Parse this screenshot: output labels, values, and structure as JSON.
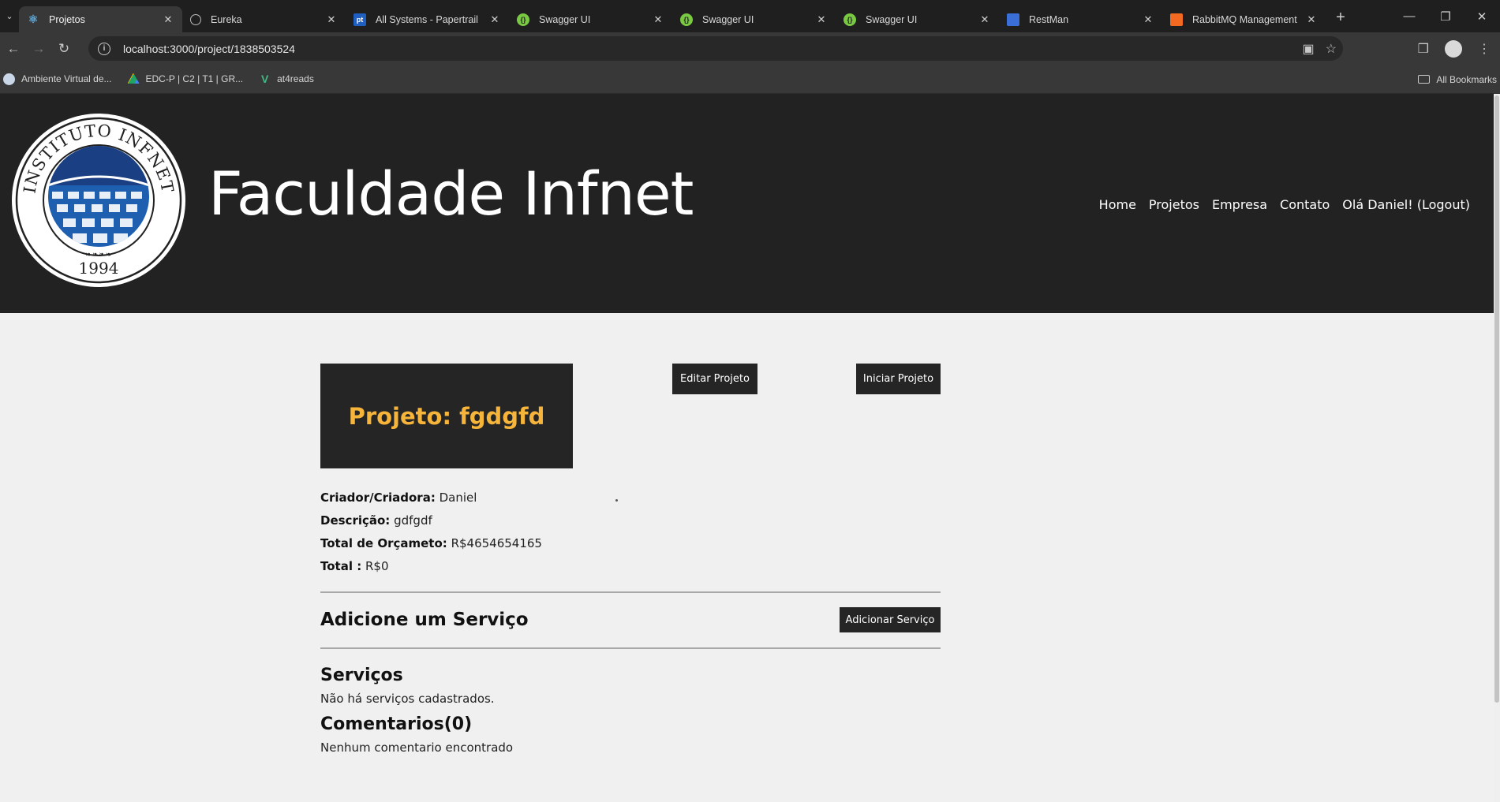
{
  "browser": {
    "tabs": [
      {
        "title": "Projetos",
        "icon": "react-icon",
        "color": "#5fa9d8",
        "active": true
      },
      {
        "title": "Eureka",
        "icon": "globe-icon",
        "color": "#9a9a9a",
        "active": false
      },
      {
        "title": "All Systems - Papertrail",
        "icon": "papertrail-icon",
        "color": "#1f5fbf",
        "active": false
      },
      {
        "title": "Swagger UI",
        "icon": "swagger-icon",
        "color": "#7ac943",
        "active": false
      },
      {
        "title": "Swagger UI",
        "icon": "swagger-icon",
        "color": "#7ac943",
        "active": false
      },
      {
        "title": "Swagger UI",
        "icon": "swagger-icon",
        "color": "#7ac943",
        "active": false
      },
      {
        "title": "RestMan",
        "icon": "restman-icon",
        "color": "#3b6fd8",
        "active": false
      },
      {
        "title": "RabbitMQ Management",
        "icon": "rabbitmq-icon",
        "color": "#f26a21",
        "active": false
      }
    ],
    "papertrail_badge": "pt",
    "url": "localhost:3000/project/1838503524",
    "bookmarks": [
      {
        "label": "Ambiente Virtual de...",
        "icon": "moodle-icon"
      },
      {
        "label": "EDC-P | C2 | T1 | GR...",
        "icon": "drive-icon"
      },
      {
        "label": "at4reads",
        "icon": "vue-icon"
      }
    ],
    "all_bookmarks": "All Bookmarks"
  },
  "site": {
    "title": "Faculdade Infnet",
    "logo": {
      "ring_text": "INSTITUTO INFNET",
      "year": "1994"
    },
    "nav": [
      "Home",
      "Projetos",
      "Empresa",
      "Contato",
      "Olá Daniel! (Logout)"
    ]
  },
  "project": {
    "title": "Projeto: fgdgfd",
    "edit_button": "Editar Projeto",
    "start_button": "Iniciar Projeto",
    "creator_label": "Criador/Criadora:",
    "creator_value": "Daniel",
    "description_label": "Descrição:",
    "description_value": "gdfgdf",
    "budget_label": "Total de Orçameto:",
    "budget_value": "R$4654654165",
    "total_label": "Total :",
    "total_value": "R$0",
    "add_service_heading": "Adicione um Serviço",
    "add_service_button": "Adicionar Serviço",
    "services_heading": "Serviços",
    "services_empty": "Não há serviços cadastrados.",
    "comments_heading": "Comentarios(0)",
    "comments_empty": "Nenhum comentario encontrado"
  },
  "colors": {
    "header_bg": "#222222",
    "project_title": "#f6b53a",
    "logo_blue": "#1f5fb0"
  }
}
